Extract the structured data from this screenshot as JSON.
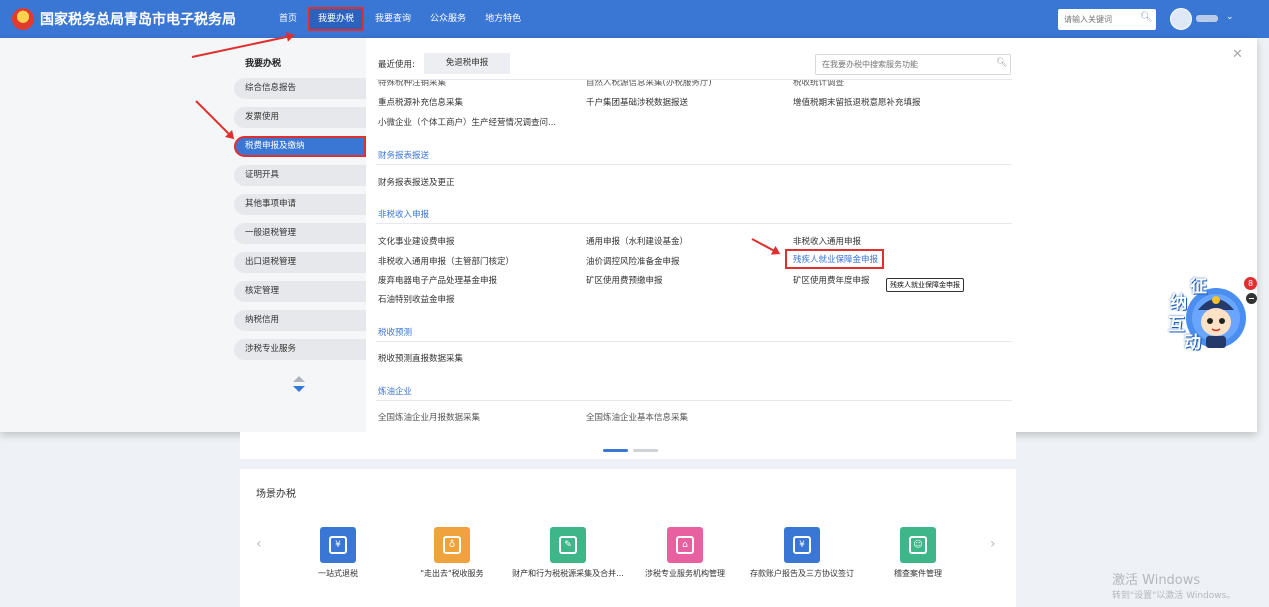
{
  "header": {
    "site_title": "国家税务总局青岛市电子税务局",
    "nav": [
      "首页",
      "我要办税",
      "我要查询",
      "公众服务",
      "地方特色"
    ],
    "search_placeholder": "请输入关键词",
    "active_nav": "我要办税"
  },
  "left_menu": {
    "title": "我要办税",
    "items": [
      "综合信息报告",
      "发票使用",
      "税费申报及缴纳",
      "证明开具",
      "其他事项申请",
      "一般退税管理",
      "出口退税管理",
      "核定管理",
      "纳税信用",
      "涉税专业服务"
    ],
    "active_item": "税费申报及缴纳"
  },
  "panel": {
    "recent_label": "最近使用:",
    "recent_chip": "免退税申报",
    "search_placeholder": "在我要办税中搜索服务功能",
    "top_cut_row": [
      "特殊税种注销采集",
      "自然人税源信息采集(办税服务厅)",
      "税收统计调查"
    ],
    "row_1": [
      "重点税源补充信息采集",
      "千户集团基础涉税数据报送",
      "增值税期末留抵退税意愿补充填报"
    ],
    "row_2": "小微企业（个体工商户）生产经营情况调查问...",
    "section_finance": "财务报表报送",
    "finance_item": "财务报表报送及更正",
    "section_nontax": "非税收入申报",
    "nontax_col1": [
      "文化事业建设费申报",
      "非税收入通用申报（主管部门核定）",
      "废弃电器电子产品处理基金申报",
      "石油特别收益金申报"
    ],
    "nontax_col2": [
      "通用申报（水利建设基金）",
      "油价调控风险准备金申报",
      "矿区使用费预缴申报"
    ],
    "nontax_col3": [
      "非税收入通用申报",
      "残疾人就业保障金申报",
      "矿区使用费年度申报"
    ],
    "tooltip": "残疾人就业保障金申报",
    "section_forecast": "税收预测",
    "forecast_item": "税收预测直报数据采集",
    "section_refinery": "炼油企业",
    "refinery_cut_row": [
      "全国炼油企业月报数据采集",
      "全国炼油企业基本信息采集"
    ]
  },
  "scene": {
    "title": "场景办税",
    "tiles": [
      {
        "label": "一站式退税",
        "color": "#3a76d4",
        "icon": "refund-icon"
      },
      {
        "label": "\"走出去\"税收服务",
        "color": "#f0a23c",
        "icon": "globe-icon"
      },
      {
        "label": "财产和行为税税源采集及合并...",
        "color": "#3fb58a",
        "icon": "edit-doc-icon"
      },
      {
        "label": "涉税专业服务机构管理",
        "color": "#e8609f",
        "icon": "building-icon"
      },
      {
        "label": "存款账户报告及三方协议签订",
        "color": "#3a76d4",
        "icon": "yuan-shield-icon"
      },
      {
        "label": "稽查案件管理",
        "color": "#3fb58a",
        "icon": "person-card-icon"
      }
    ]
  },
  "widget": {
    "chars": [
      "征",
      "纳",
      "互",
      "动"
    ],
    "badge": "8"
  },
  "watermark": {
    "line1": "激活 Windows",
    "line2": "转到\"设置\"以激活 Windows。"
  }
}
